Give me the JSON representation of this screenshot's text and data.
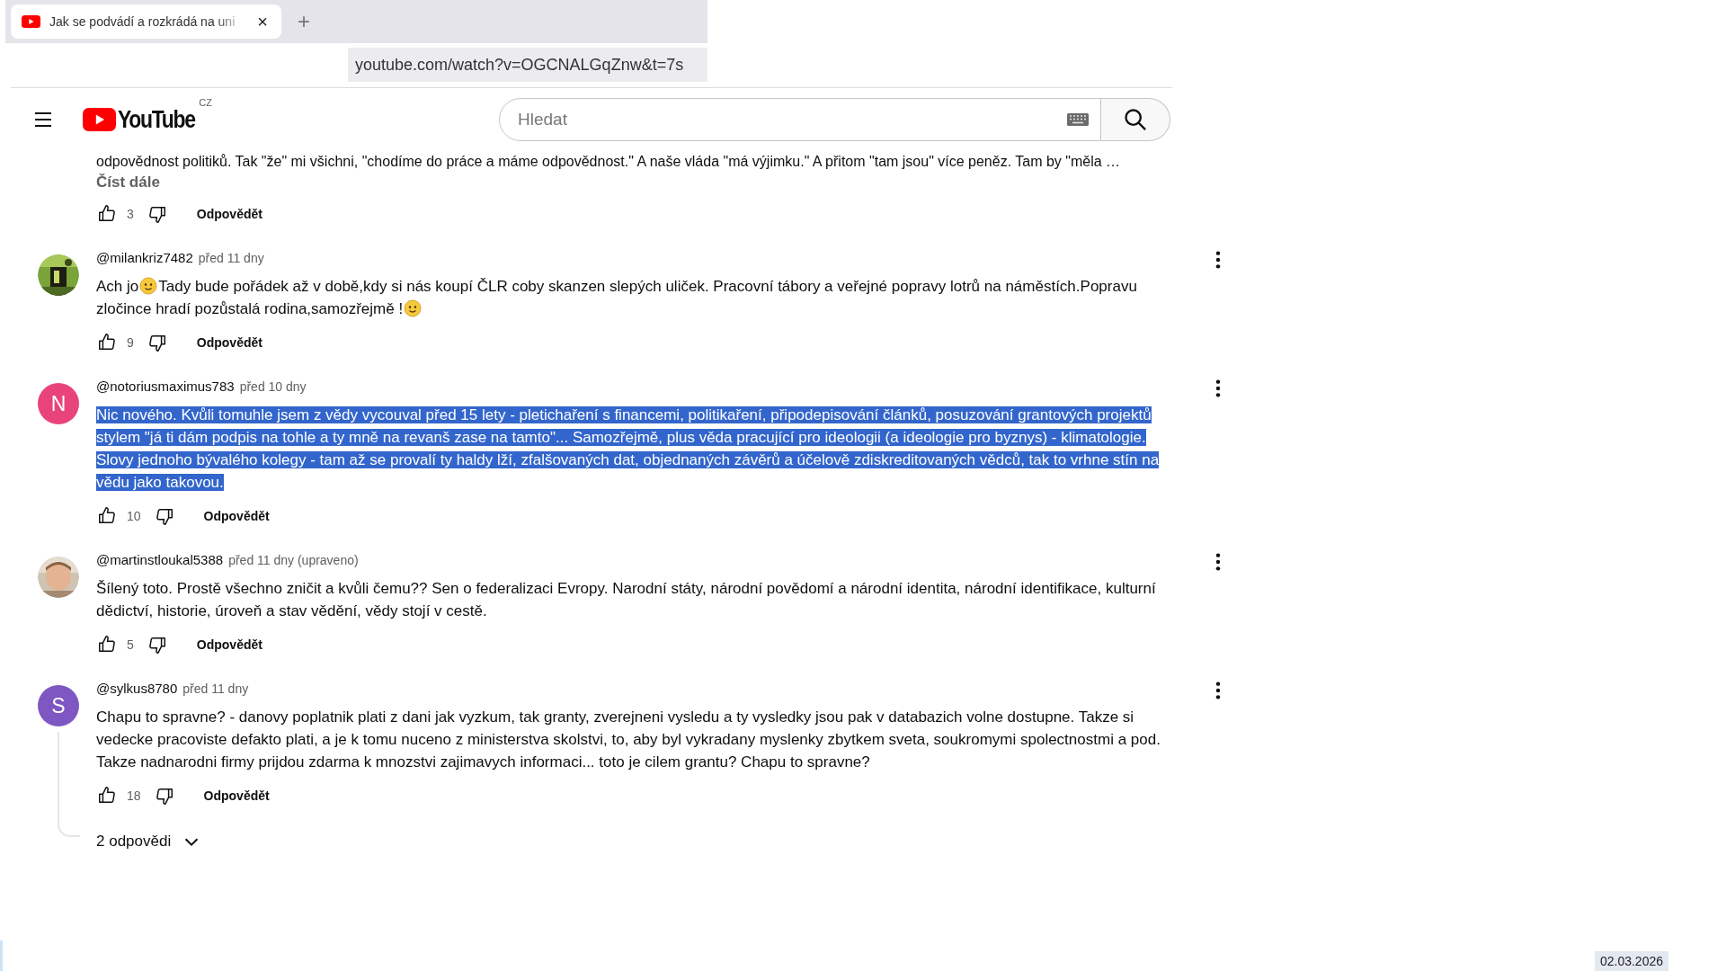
{
  "browser": {
    "tab": {
      "title": "Jak se podvádí a rozkrádá na uni",
      "close": "×",
      "selected": true
    },
    "new_tab": "+",
    "url": "youtube.com/watch?v=OGCNALGqZnw&t=7s"
  },
  "header": {
    "logo": "YouTube",
    "region": "CZ",
    "search": {
      "placeholder": "Hledat"
    }
  },
  "partial_comment": {
    "text": "odpovědnost politiků. Tak \"že\" mi všichni, \"chodíme do práce a máme odpovědnost.\" A naše vláda \"má výjimku.\" A přitom \"tam jsou\" více peněz. Tam by \"měla …",
    "read_more": "Číst dále",
    "likes": "3",
    "reply": "Odpovědět"
  },
  "comments": [
    {
      "author": "@milankriz7482",
      "time": "před 11 dny",
      "text_selected": false,
      "body": [
        {
          "kind": "text",
          "text": "Ach jo"
        },
        {
          "kind": "emoji"
        },
        {
          "kind": "text",
          "text": "Tady bude pořádek až v době,kdy si nás koupí ČLR coby skanzen slepých uliček. Pracovní tábory a veřejné popravy lotrů na náměstích.Popravu zločince hradí pozůstalá rodina,samozřejmě !"
        },
        {
          "kind": "emoji"
        }
      ],
      "likes": "9",
      "reply": "Odpovědět"
    },
    {
      "author": "@notoriusmaximus783",
      "time": "před 10 dny",
      "avatar": {
        "kind": "letter",
        "letter": "N",
        "color": "#e8437a"
      },
      "text_selected": true,
      "body": [
        {
          "kind": "text",
          "text": "Nic nového. Kvůli tomuhle jsem z vědy vycouval před 15 lety - pletichaření s financemi, politikaření, připodepisování článků, posuzování grantových projektů stylem \"já ti dám podpis na tohle a ty mně na revanš zase na tamto\"... Samozřejmě, plus věda pracující pro ideologii (a ideologie pro byznys) - klimatologie. Slovy jednoho bývalého kolegy - tam až se provalí ty haldy lží, zfalšovaných dat, objednaných závěrů a účelově zdiskreditovaných vědců, tak to vrhne stín na vědu jako takovou."
        }
      ],
      "likes": "10",
      "reply": "Odpovědět"
    },
    {
      "author": "@martinstloukal5388",
      "time": "před 11 dny (upraveno)",
      "text_selected": false,
      "body": [
        {
          "kind": "text",
          "text": "Šílený toto. Prostě všechno zničit a kvůli čemu?? Sen o federalizaci Evropy. Narodní státy, národní povědomí a národní identita, národní identifikace, kulturní dědictví, historie, úroveň a stav vědění, vědy stojí v cestě."
        }
      ],
      "likes": "5",
      "reply": "Odpovědět"
    },
    {
      "author": "@sylkus8780",
      "time": "před 11 dny",
      "avatar": {
        "kind": "letter",
        "letter": "S",
        "color": "#7e57c2"
      },
      "text_selected": false,
      "body": [
        {
          "kind": "text",
          "text": "Chapu to spravne? - danovy poplatnik plati z dani jak vyzkum, tak granty, zverejneni vysledu a ty vysledky jsou pak v databazich volne dostupne. Takze si vedecke pracoviste defakto plati, a je k tomu nuceno z ministerstva skolstvi, to, aby byl vykradany myslenky zbytkem sveta, soukromymi spolectnostmi a pod. Takze nadnarodni firmy prijdou zdarma k mnozstvi zajimavych informaci... toto je cilem grantu? Chapu to spravne?"
        }
      ],
      "likes": "18",
      "reply": "Odpovědět",
      "replies": {
        "label": "2 odpovědi",
        "expanded": false
      }
    }
  ],
  "taskbar": {
    "date": "02.03.2026"
  }
}
